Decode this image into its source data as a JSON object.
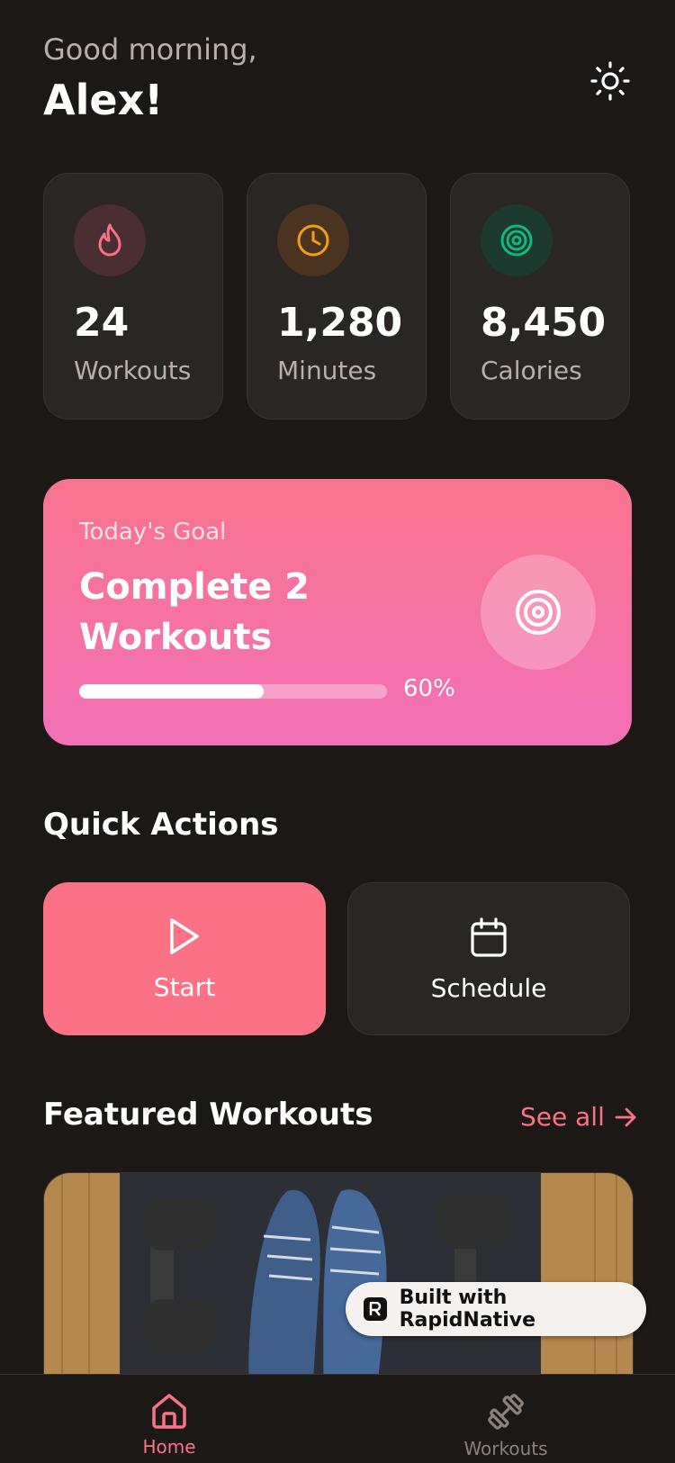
{
  "header": {
    "greeting": "Good morning,",
    "name": "Alex!"
  },
  "stats": [
    {
      "value": "24",
      "label": "Workouts",
      "icon": "flame-icon",
      "color": "#fb7185"
    },
    {
      "value": "1,280",
      "label": "Minutes",
      "icon": "clock-icon",
      "color": "#f59e0b"
    },
    {
      "value": "8,450",
      "label": "Calories",
      "icon": "target-icon",
      "color": "#10b981"
    }
  ],
  "goal": {
    "subtitle": "Today's Goal",
    "title": "Complete 2 Workouts",
    "progress": 0.6,
    "progress_label": "60%",
    "icon": "target-icon"
  },
  "quick_actions": {
    "title": "Quick Actions",
    "start_label": "Start",
    "schedule_label": "Schedule"
  },
  "featured": {
    "title": "Featured Workouts",
    "see_all": "See all"
  },
  "badge": {
    "label": "Built with RapidNative"
  },
  "tabs": [
    {
      "label": "Home",
      "icon": "home-icon",
      "active": true
    },
    {
      "label": "Workouts",
      "icon": "dumbbell-icon",
      "active": false
    }
  ],
  "colors": {
    "background": "#1c1816",
    "accent": "#fb7185",
    "card": "#2a2624",
    "muted": "#b8afa8"
  }
}
